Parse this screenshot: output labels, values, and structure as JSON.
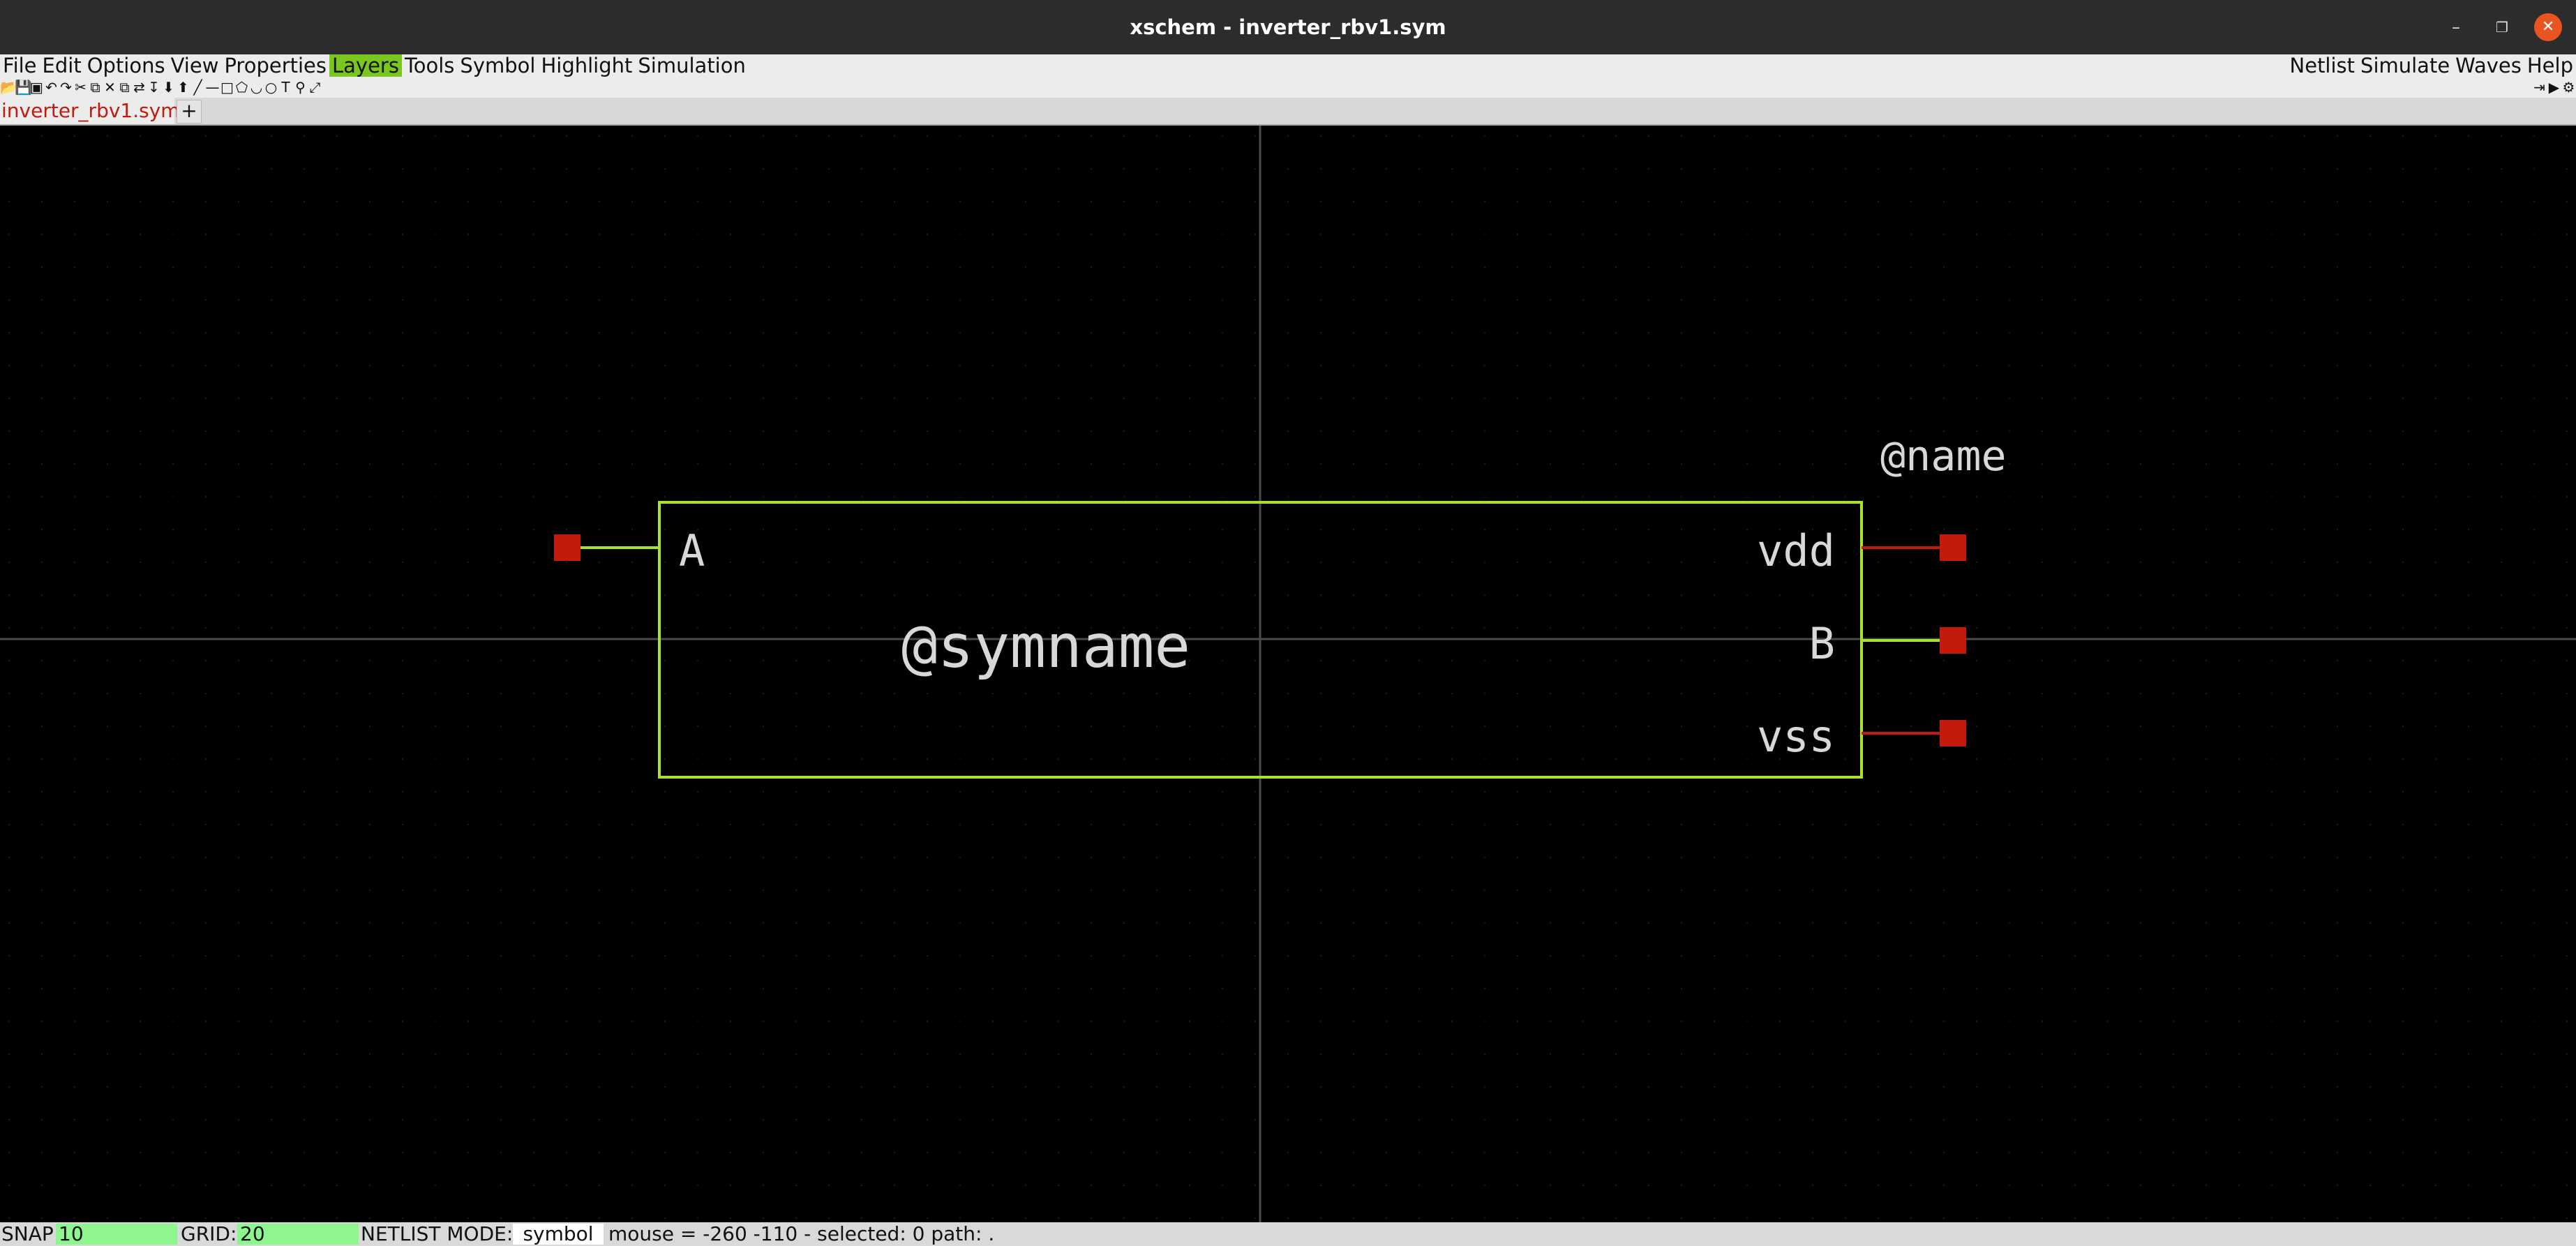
{
  "window": {
    "title": "xschem - inverter_rbv1.sym",
    "minimize_icon": "minimize-icon",
    "maximize_icon": "restore-icon",
    "close_icon": "close-icon"
  },
  "menubar": {
    "left_items": [
      "File",
      "Edit",
      "Options",
      "View",
      "Properties",
      "Layers",
      "Tools",
      "Symbol",
      "Highlight",
      "Simulation"
    ],
    "highlighted": "Layers",
    "right_items": [
      "Netlist",
      "Simulate",
      "Waves",
      "Help"
    ],
    "highlight_color": "#7ac71f"
  },
  "toolbar": {
    "icons": [
      "open-icon",
      "save-icon",
      "new-window-icon",
      "undo-icon",
      "redo-icon",
      "cut-icon",
      "copy-icon",
      "delete-icon",
      "duplicate-icon",
      "move-icon",
      "insert-symbol-icon",
      "descend-icon",
      "ascend-icon",
      "wire-icon",
      "line-icon",
      "rect-icon",
      "polygon-icon",
      "arc-icon",
      "circle-icon",
      "text-icon",
      "zoom-icon",
      "zoom-fit-icon"
    ],
    "right_icons": [
      "collapse-toolbar-icon",
      "forward-icon",
      "settings-icon"
    ]
  },
  "tabs": {
    "active_label": "inverter_rbv1.sym",
    "add_label": "+"
  },
  "schematic": {
    "box_color": "#a6e22e",
    "pin_color": "#c41a0b",
    "text_color": "#d8d8d8",
    "grid_axis_color": "#4a4a4a",
    "pins": {
      "A": "A",
      "vdd": "vdd",
      "B": "B",
      "vss": "vss"
    },
    "symname": "@symname",
    "name": "@name"
  },
  "status": {
    "snap_label": "SNAP:",
    "snap_value": "10",
    "grid_label": "GRID:",
    "grid_value": "20",
    "netlist_mode_label": "NETLIST MODE:",
    "netlist_mode_value": "symbol",
    "info": "mouse = -260 -110 - selected: 0 path: ."
  }
}
